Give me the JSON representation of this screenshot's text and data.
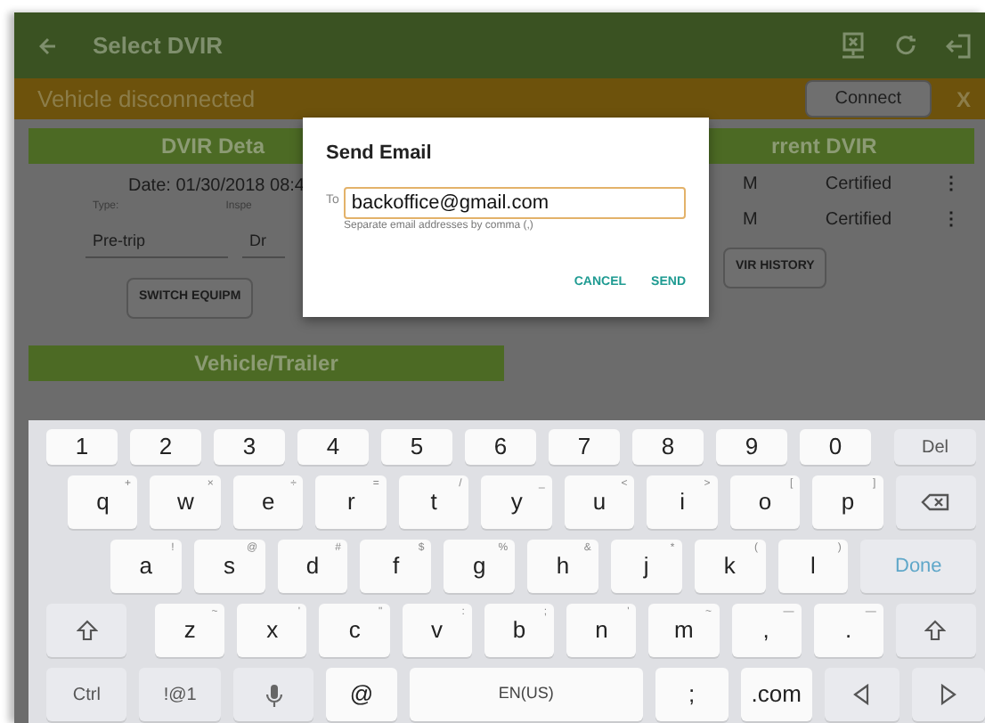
{
  "toolbar": {
    "title": "Select DVIR"
  },
  "banner": {
    "text": "Vehicle disconnected",
    "button": "Connect",
    "close": "X"
  },
  "dvir_details": {
    "header": "DVIR Deta",
    "date": "Date: 01/30/2018 08:4",
    "type_label": "Type:",
    "column_2_label": "Inspe",
    "type_value": "Pre-trip",
    "column_2_value": "Dr",
    "switch_button": "SWITCH EQUIPM",
    "vehicle_header": "Vehicle/Trailer"
  },
  "current_dvir": {
    "header": "rrent DVIR",
    "rows": [
      {
        "time": "M",
        "status": "Certified",
        "menu": "⋮"
      },
      {
        "time": "M",
        "status": "Certified",
        "menu": "⋮"
      }
    ],
    "history_button": "VIR HISTORY"
  },
  "dialog": {
    "title": "Send Email",
    "to_label": "To",
    "value": "backoffice@gmail.com",
    "hint": "Separate email addresses by comma (,)",
    "buttons": [
      "CANCEL",
      "SEND"
    ]
  },
  "keyboard": {
    "key_rows": [
      {
        "keys": [
          {
            "kind": "char",
            "label": "1"
          },
          {
            "kind": "char",
            "label": "2"
          },
          {
            "kind": "char",
            "label": "3"
          },
          {
            "kind": "char",
            "label": "4"
          },
          {
            "kind": "char",
            "label": "5"
          },
          {
            "kind": "char",
            "label": "6"
          },
          {
            "kind": "char",
            "label": "7"
          },
          {
            "kind": "char",
            "label": "8"
          },
          {
            "kind": "char",
            "label": "9"
          },
          {
            "kind": "char",
            "label": "0"
          },
          {
            "kind": "func",
            "label": "Del"
          }
        ]
      },
      {
        "keys": [
          {
            "kind": "char",
            "label": "q",
            "hint": "+"
          },
          {
            "kind": "char",
            "label": "w",
            "hint": "×"
          },
          {
            "kind": "char",
            "label": "e",
            "hint": "÷"
          },
          {
            "kind": "char",
            "label": "r",
            "hint": "="
          },
          {
            "kind": "char",
            "label": "t",
            "hint": "/"
          },
          {
            "kind": "char",
            "label": "y",
            "hint": "_"
          },
          {
            "kind": "char",
            "label": "u",
            "hint": "<"
          },
          {
            "kind": "char",
            "label": "i",
            "hint": ">"
          },
          {
            "kind": "char",
            "label": "o",
            "hint": "["
          },
          {
            "kind": "char",
            "label": "p",
            "hint": "]"
          },
          {
            "kind": "backspace"
          }
        ]
      },
      {
        "keys": [
          {
            "kind": "char",
            "label": "a",
            "hint": "!"
          },
          {
            "kind": "char",
            "label": "s",
            "hint": "@"
          },
          {
            "kind": "char",
            "label": "d",
            "hint": "#"
          },
          {
            "kind": "char",
            "label": "f",
            "hint": "$"
          },
          {
            "kind": "char",
            "label": "g",
            "hint": "%"
          },
          {
            "kind": "char",
            "label": "h",
            "hint": "&"
          },
          {
            "kind": "char",
            "label": "j",
            "hint": "*"
          },
          {
            "kind": "char",
            "label": "k",
            "hint": "("
          },
          {
            "kind": "char",
            "label": "l",
            "hint": ")"
          },
          {
            "kind": "done",
            "label": "Done"
          }
        ]
      },
      {
        "keys": [
          {
            "kind": "shift"
          },
          {
            "kind": "char",
            "label": "z",
            "hint": "~"
          },
          {
            "kind": "char",
            "label": "x",
            "hint": "'"
          },
          {
            "kind": "char",
            "label": "c",
            "hint": "\""
          },
          {
            "kind": "char",
            "label": "v",
            "hint": ":"
          },
          {
            "kind": "char",
            "label": "b",
            "hint": ";"
          },
          {
            "kind": "char",
            "label": "n",
            "hint": "'"
          },
          {
            "kind": "char",
            "label": "m",
            "hint": "~"
          },
          {
            "kind": "char",
            "label": ",",
            "hint": "—"
          },
          {
            "kind": "char",
            "label": ".",
            "hint": "—"
          },
          {
            "kind": "shift"
          }
        ]
      },
      {
        "keys": [
          {
            "kind": "func",
            "label": "Ctrl"
          },
          {
            "kind": "func",
            "label": "!@1"
          },
          {
            "kind": "mic"
          },
          {
            "kind": "char",
            "label": "@"
          },
          {
            "kind": "space",
            "label": "EN(US)"
          },
          {
            "kind": "char",
            "label": ";"
          },
          {
            "kind": "char",
            "label": ".com"
          },
          {
            "kind": "left"
          },
          {
            "kind": "right"
          }
        ]
      }
    ]
  }
}
